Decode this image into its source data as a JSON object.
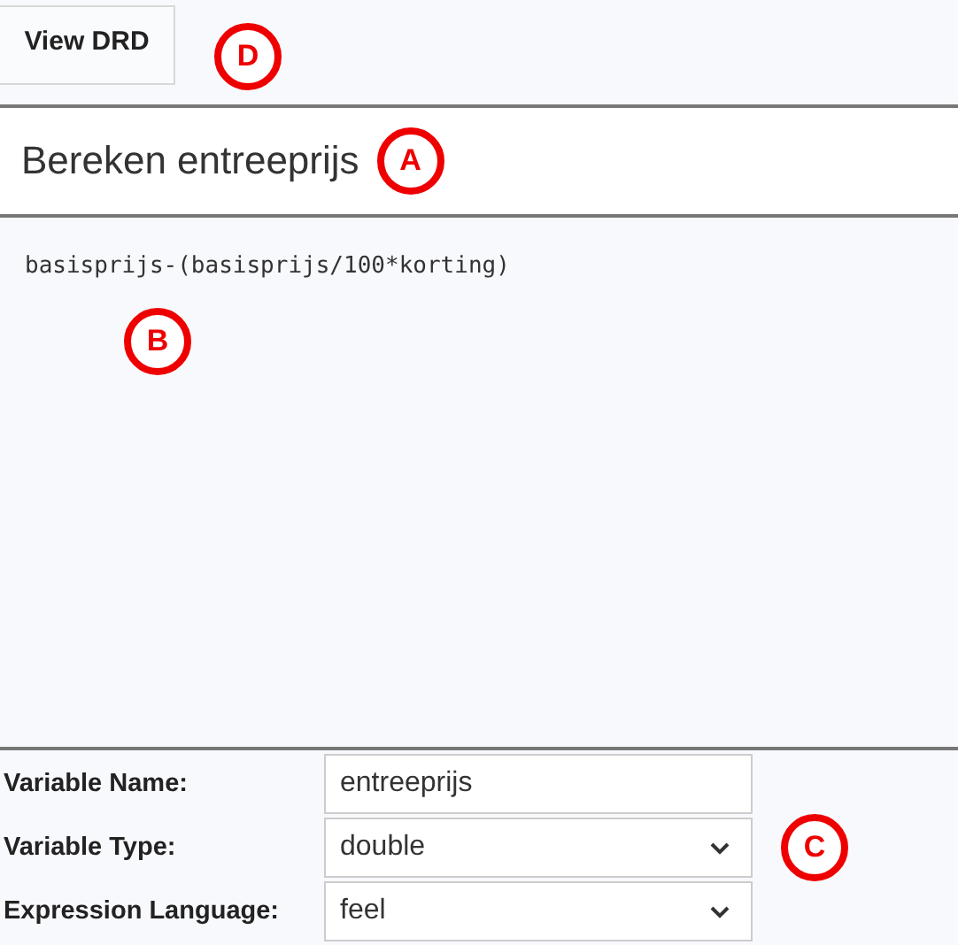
{
  "toolbar": {
    "button": "View DRD",
    "callout": "D"
  },
  "header": {
    "title": "Bereken entreeprijs",
    "callout": "A"
  },
  "expression": {
    "text": "basisprijs-(basisprijs/100*korting)",
    "callout": "B"
  },
  "form": {
    "callout": "C",
    "fields": [
      {
        "kind": "text",
        "label": "Variable Name:",
        "value": "entreeprijs"
      },
      {
        "kind": "select",
        "label": "Variable Type:",
        "value": "double"
      },
      {
        "kind": "select",
        "label": "Expression Language:",
        "value": "feel"
      }
    ]
  }
}
